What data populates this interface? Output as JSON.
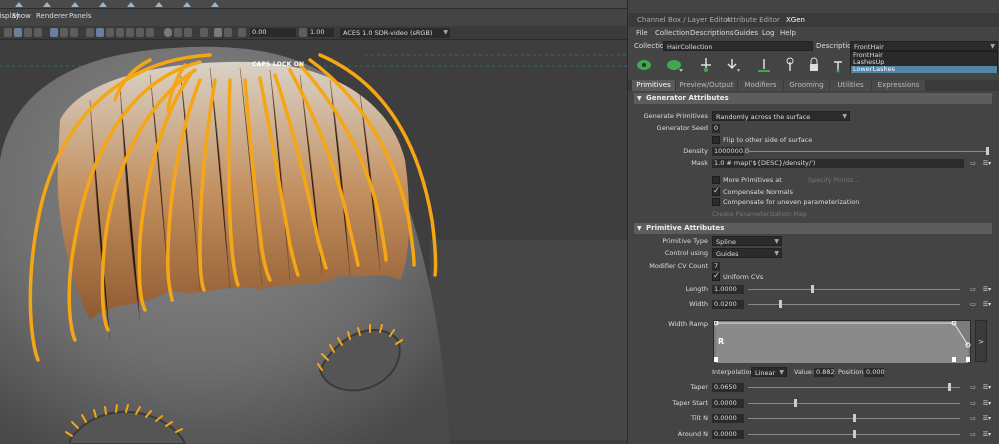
{
  "viewport": {
    "menu": [
      "Display",
      "Show",
      "Renderer",
      "Panels"
    ],
    "toolbar": {
      "exposure": "0.00",
      "gamma": "1.00",
      "colorspace": "ACES 1.0 SDR-video (sRGB)"
    },
    "caps_lock": "CAPS LOCK ON"
  },
  "panel": {
    "tabs": [
      "Channel Box / Layer Editor",
      "Attribute Editor",
      "XGen"
    ],
    "active_tab": "XGen",
    "menu": [
      "File",
      "Collection",
      "Descriptions",
      "Guides",
      "Log",
      "Help"
    ],
    "collection": {
      "label": "Collection",
      "value": "HairCollection"
    },
    "description": {
      "label": "Description",
      "value": "FrontHair",
      "options": [
        "FrontHair",
        "LashesUp",
        "LowerLashes"
      ],
      "selected": "LowerLashes"
    },
    "sub_tabs": [
      "Primitives",
      "Preview/Output",
      "Modifiers",
      "Grooming",
      "Utilities",
      "Expressions"
    ],
    "active_sub_tab": "Primitives",
    "generator": {
      "title": "Generator Attributes",
      "generate_primitives": {
        "label": "Generate Primitives",
        "value": "Randomly across the surface"
      },
      "generator_seed": {
        "label": "Generator Seed",
        "value": "0"
      },
      "flip": {
        "label": "Flip to other side of surface",
        "checked": false
      },
      "density": {
        "label": "Density",
        "value": "1000000.0"
      },
      "mask": {
        "label": "Mask",
        "value": "1.0 # map('${DESC}/density/')"
      },
      "more_primitives": {
        "label": "More Primitives at",
        "link": "Specify Points..."
      },
      "compensate_normals": {
        "label": "Compensate Normals",
        "checked": true
      },
      "compensate_uneven": {
        "label": "Compensate for uneven parameterization",
        "checked": false
      },
      "create_map": "Create Parameterization Map"
    },
    "primitive": {
      "title": "Primitive Attributes",
      "primitive_type": {
        "label": "Primitive Type",
        "value": "Spline"
      },
      "control_using": {
        "label": "Control using",
        "value": "Guides"
      },
      "cv_count": {
        "label": "Modifier CV Count",
        "value": "7"
      },
      "uniform_cvs": {
        "label": "Uniform CVs",
        "checked": true
      },
      "length": {
        "label": "Length",
        "value": "1.0000",
        "level": 0.3
      },
      "width": {
        "label": "Width",
        "value": "0.0200",
        "level": 0.15
      },
      "width_ramp": {
        "label": "Width Ramp",
        "marker": "R",
        "side_label": ">"
      },
      "interpolation": {
        "label": "Interpolation",
        "value": "Linear"
      },
      "ramp_value": {
        "label": "Value:",
        "value": "0.882"
      },
      "ramp_position": {
        "label": "Position:",
        "value": "0.000"
      },
      "taper": {
        "label": "Taper",
        "value": "0.0650",
        "level": 0.95
      },
      "taper_start": {
        "label": "Taper Start",
        "value": "0.0000",
        "level": 0.22
      },
      "tilt_n": {
        "label": "Tilt N",
        "value": "0.0000",
        "level": 0.5
      },
      "around_n": {
        "label": "Around N",
        "value": "0.0000",
        "level": 0.5
      }
    }
  },
  "colors": {
    "guide": "#f5a614",
    "hair": "#b4703a",
    "highlight": "#5285a6",
    "panel_bg": "#444444"
  }
}
